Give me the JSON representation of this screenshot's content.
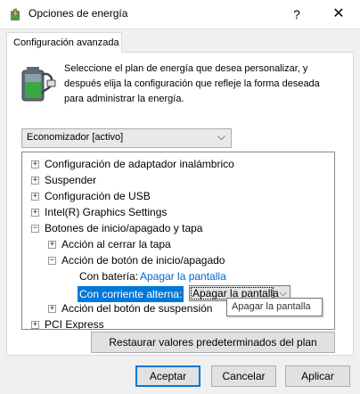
{
  "window": {
    "title": "Opciones de energía",
    "help_glyph": "?",
    "close_glyph": "✕"
  },
  "tab": {
    "label": "Configuración avanzada"
  },
  "description": "Seleccione el plan de energía que desea personalizar, y después elija la configuración que refleje la forma deseada para administrar la energía.",
  "plan_select": {
    "value": "Economizador [activo]",
    "chevron": "⌵"
  },
  "tree": {
    "expanded_glyph": "−",
    "collapsed_glyph": "+",
    "items": [
      {
        "label": "Configuración de adaptador inalámbrico",
        "state": "collapsed"
      },
      {
        "label": "Suspender",
        "state": "collapsed"
      },
      {
        "label": "Configuración de USB",
        "state": "collapsed"
      },
      {
        "label": "Intel(R) Graphics Settings",
        "state": "collapsed"
      },
      {
        "label": "Botones de inicio/apagado y tapa",
        "state": "expanded"
      },
      {
        "label": "Acción al cerrar la tapa",
        "state": "collapsed"
      },
      {
        "label": "Acción de botón de inicio/apagado",
        "state": "expanded"
      },
      {
        "label": "Con batería:",
        "value": "Apagar la pantalla"
      },
      {
        "label": "Con corriente alterna:",
        "value": "Apagar la pantalla"
      },
      {
        "label": "Acción del botón de suspensión",
        "state": "collapsed"
      },
      {
        "label": "PCI Express",
        "state": "collapsed"
      }
    ]
  },
  "tooltip": "Apagar la pantalla",
  "buttons": {
    "restore": "Restaurar valores predeterminados del plan",
    "ok": "Aceptar",
    "cancel": "Cancelar",
    "apply": "Aplicar"
  },
  "colors": {
    "selection": "#0078d7",
    "link": "#0066cc",
    "battery_green": "#3aa845"
  }
}
